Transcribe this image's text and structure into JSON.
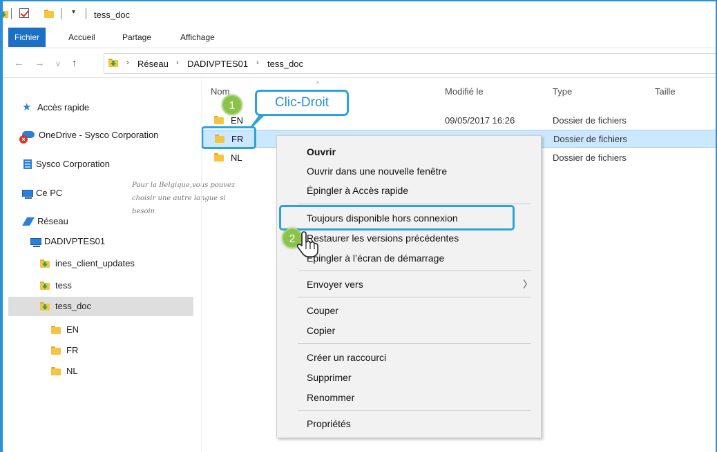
{
  "window": {
    "title": "tess_doc"
  },
  "ribbon": {
    "tabs": [
      "Fichier",
      "Accueil",
      "Partage",
      "Affichage"
    ],
    "active": 0
  },
  "address": {
    "crumbs": [
      "Réseau",
      "DADIVPTES01",
      "tess_doc"
    ]
  },
  "nav": {
    "quick_access": "Accès rapide",
    "onedrive": "OneDrive - Sysco Corporation",
    "sysco": "Sysco Corporation",
    "this_pc": "Ce PC",
    "network": "Réseau",
    "server": "DADIVPTES01",
    "folders": [
      "ines_client_updates",
      "tess",
      "tess_doc"
    ],
    "subfolders": [
      "EN",
      "FR",
      "NL"
    ]
  },
  "hint": "Pour la Belgique,vous pouvez choisir une autre langue si besoin",
  "columns": {
    "name": "Nom",
    "modified": "Modifié le",
    "type": "Type",
    "size": "Taille"
  },
  "files": [
    {
      "name": "EN",
      "modified": "09/05/2017 16:26",
      "type": "Dossier de fichiers"
    },
    {
      "name": "FR",
      "modified": "",
      "type": "Dossier de fichiers"
    },
    {
      "name": "NL",
      "modified": "",
      "type": "Dossier de fichiers"
    }
  ],
  "callout": {
    "label": "Clic-Droit",
    "step1": "1",
    "step2": "2"
  },
  "context_menu": {
    "open": "Ouvrir",
    "open_new": "Ouvrir dans une nouvelle fenêtre",
    "pin_quick": "Épingler à Accès rapide",
    "offline": "Toujours disponible hors connexion",
    "restore": "Restaurer les versions précédentes",
    "pin_start": "Épingler à l’écran de démarrage",
    "send_to": "Envoyer vers",
    "cut": "Couper",
    "copy": "Copier",
    "shortcut": "Créer un raccourci",
    "delete": "Supprimer",
    "rename": "Renommer",
    "properties": "Propriétés"
  }
}
